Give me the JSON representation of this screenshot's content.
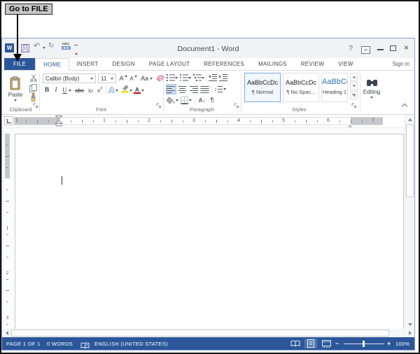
{
  "annotation": {
    "label": "Go to FILE"
  },
  "titlebar": {
    "title": "Document1 - Word",
    "sign_in": "Sign in"
  },
  "icons": {
    "word_logo": "W",
    "undo": "↶",
    "redo": "↻",
    "spelling": "ABC",
    "help": "?",
    "close": "×",
    "pilcrow": "¶",
    "sort": "A↓",
    "line_spacing": "↕",
    "zoom_out": "−",
    "zoom_in": "+"
  },
  "tabs": [
    {
      "label": "FILE"
    },
    {
      "label": "HOME"
    },
    {
      "label": "INSERT"
    },
    {
      "label": "DESIGN"
    },
    {
      "label": "PAGE LAYOUT"
    },
    {
      "label": "REFERENCES"
    },
    {
      "label": "MAILINGS"
    },
    {
      "label": "REVIEW"
    },
    {
      "label": "VIEW"
    }
  ],
  "ribbon": {
    "clipboard": {
      "label": "Clipboard",
      "paste": "Paste"
    },
    "font": {
      "label": "Font",
      "name": "Calibri (Body)",
      "size": "11",
      "grow": "A",
      "shrink": "A",
      "case": "Aa",
      "bold": "B",
      "italic": "I",
      "underline": "U",
      "strike": "abc",
      "sub": "x",
      "sub_s": "2",
      "sup": "x",
      "sup_s": "2",
      "effects": "A",
      "color": "A"
    },
    "paragraph": {
      "label": "Paragraph"
    },
    "styles": {
      "label": "Styles",
      "cards": [
        {
          "preview": "AaBbCcDc",
          "name": "¶ Normal"
        },
        {
          "preview": "AaBbCcDc",
          "name": "¶ No Spac..."
        },
        {
          "preview": "AaBbCc",
          "name": "Heading 1"
        }
      ]
    },
    "editing": {
      "label": "Editing"
    }
  },
  "ruler": {
    "h": [
      "1",
      "1",
      "2",
      "3",
      "4",
      "5",
      "6",
      "7"
    ],
    "v": [
      "1",
      "2",
      "3"
    ]
  },
  "statusbar": {
    "page": "PAGE 1 OF 1",
    "words": "0 WORDS",
    "language": "ENGLISH (UNITED STATES)",
    "zoom": "100%"
  }
}
